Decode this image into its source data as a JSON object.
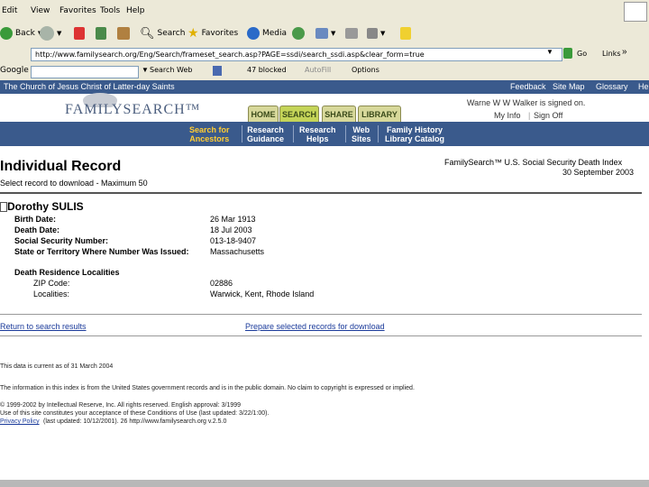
{
  "menu": [
    "Edit",
    "View",
    "Favorites",
    "Tools",
    "Help"
  ],
  "toolbar": {
    "back": "Back",
    "search": "Search",
    "favorites": "Favorites",
    "media": "Media"
  },
  "address": {
    "url": "http://www.familysearch.org/Eng/Search/frameset_search.asp?PAGE=ssdi/search_ssdi.asp&clear_form=true",
    "go": "Go",
    "links": "Links"
  },
  "googlebar": {
    "label": "Google -",
    "search_web": "Search Web",
    "blocked": "47 blocked",
    "autofill": "AutoFill",
    "options": "Options"
  },
  "site": {
    "top_left": "The Church of Jesus Christ of Latter-day Saints",
    "top_right_links": [
      "Feedback",
      "Site Map",
      "Glossary",
      "Help"
    ],
    "logo": "FAMILYSEARCH™",
    "tabs": [
      "HOME",
      "SEARCH",
      "SHARE",
      "LIBRARY"
    ],
    "signed_in": "Warne W W Walker is signed on.",
    "account_links": [
      "My Info",
      "Sign Off"
    ],
    "nav": [
      {
        "l1": "Search for",
        "l2": "Ancestors"
      },
      {
        "l1": "Research",
        "l2": "Guidance"
      },
      {
        "l1": "Research",
        "l2": "Helps"
      },
      {
        "l1": "Web",
        "l2": "Sites"
      },
      {
        "l1": "Family History",
        "l2": "Library Catalog"
      }
    ]
  },
  "record": {
    "page_title": "Individual Record",
    "subtitle": "Select record to download - Maximum 50",
    "source": "FamilySearch™ U.S. Social Security Death Index",
    "date": "30 September 2003",
    "name": "Dorothy SULIS",
    "fields": [
      {
        "label": "Birth Date:",
        "value": "26 Mar 1913"
      },
      {
        "label": "Death Date:",
        "value": "18 Jul 2003"
      },
      {
        "label": "Social Security Number:",
        "value": "013-18-9407"
      },
      {
        "label": "State or Territory Where Number Was Issued:",
        "value": "Massachusetts"
      }
    ],
    "residence_heading": "Death Residence Localities",
    "residence": [
      {
        "label": "ZIP Code:",
        "value": "02886"
      },
      {
        "label": "Localities:",
        "value": "Warwick, Kent, Rhode Island"
      }
    ],
    "return_link": "Return to search results",
    "prepare_link": "Prepare selected records for download"
  },
  "footer": {
    "current": "This data is current as of 31 March 2004",
    "note": "The information in this index is from the United States government records and is in the public domain. No claim to copyright is expressed or implied.",
    "copyright": "© 1999-2002 by Intellectual Reserve, Inc. All rights reserved. English approval: 3/1999",
    "conditions": "Use of this site constitutes your acceptance of these Conditions of Use (last updated: 3/22/1:00).",
    "privacy_link": "Privacy Policy",
    "privacy_rest": "(last updated: 10/12/2001).   26    http://www.familysearch.org   v.2.5.0"
  },
  "colors": {
    "nav_bg": "#3a5a8c",
    "nav_link": "#ffcc33",
    "tab_active": "#c4d458",
    "tab": "#d7d89a"
  }
}
